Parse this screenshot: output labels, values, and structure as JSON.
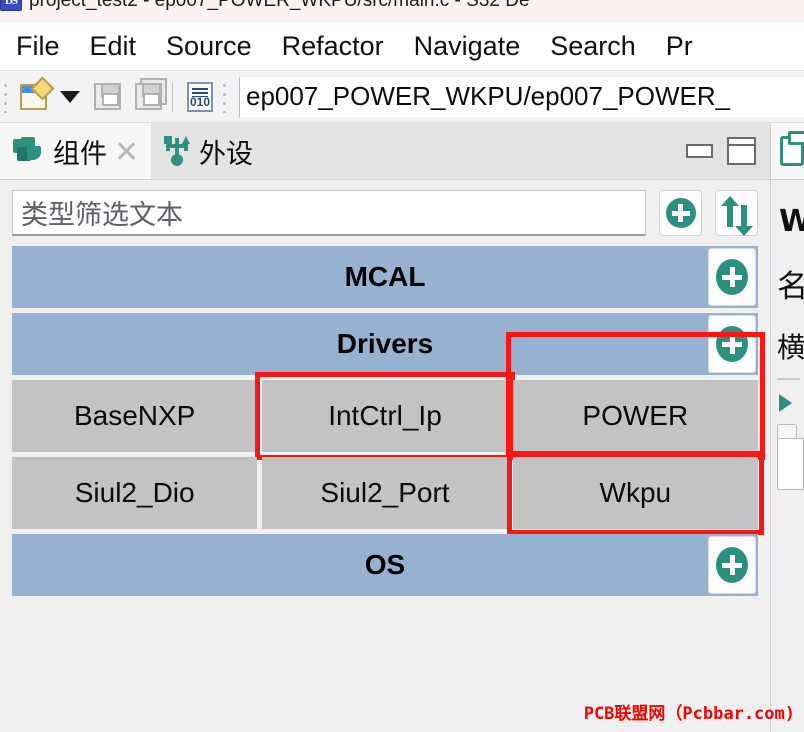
{
  "window": {
    "title": "project_test2 - ep007_POWER_WKPU/src/main.c - S32 De",
    "app_icon": "s32-design-studio-icon"
  },
  "menubar": {
    "items": [
      {
        "label": "File"
      },
      {
        "label": "Edit"
      },
      {
        "label": "Source"
      },
      {
        "label": "Refactor"
      },
      {
        "label": "Navigate"
      },
      {
        "label": "Search"
      },
      {
        "label": "Pr"
      }
    ]
  },
  "toolbar": {
    "new_icon": "new-file-icon",
    "dropdown_icon": "chevron-down-icon",
    "save_icon": "save-icon",
    "save_all_icon": "save-all-icon",
    "binary_icon": "binary-file-icon",
    "binary_label": "010",
    "address_value": "ep007_POWER_WKPU/ep007_POWER_"
  },
  "view_tabs": {
    "tabs": [
      {
        "label": "组件",
        "icon": "components-icon",
        "close_icon": "close-icon",
        "active": true
      },
      {
        "label": "外设",
        "icon": "usb-peripheral-icon",
        "active": false
      }
    ],
    "minimize_icon": "minimize-icon",
    "maximize_icon": "maximize-icon"
  },
  "filter": {
    "placeholder": "类型筛选文本",
    "add_button_icon": "plus-circle-icon",
    "sort_button_icon": "sort-arrows-icon"
  },
  "tree": {
    "categories": [
      {
        "label": "MCAL",
        "add_icon": "plus-circle-icon",
        "rows": []
      },
      {
        "label": "Drivers",
        "add_icon": "plus-circle-icon",
        "rows": [
          [
            {
              "label": "BaseNXP",
              "highlighted": false
            },
            {
              "label": "IntCtrl_Ip",
              "highlighted": true
            },
            {
              "label": "POWER",
              "highlighted": true
            }
          ],
          [
            {
              "label": "Siul2_Dio",
              "highlighted": false
            },
            {
              "label": "Siul2_Port",
              "highlighted": false
            },
            {
              "label": "Wkpu",
              "highlighted": true
            }
          ]
        ]
      },
      {
        "label": "OS",
        "add_icon": "plus-circle-icon",
        "rows": []
      }
    ]
  },
  "right_panel": {
    "tab_icon": "clipboard-icon",
    "title_fragment": "W",
    "line1_fragment": "名",
    "line2_fragment": "横"
  },
  "watermark": {
    "text": "PCB联盟网（Pcbbar.com)"
  },
  "colors": {
    "category_bar": "#96b2d0",
    "component_cell": "#c3c3c3",
    "highlight_border": "#fb1616",
    "accent_green": "#2b9080",
    "watermark_red": "#fb0000"
  }
}
